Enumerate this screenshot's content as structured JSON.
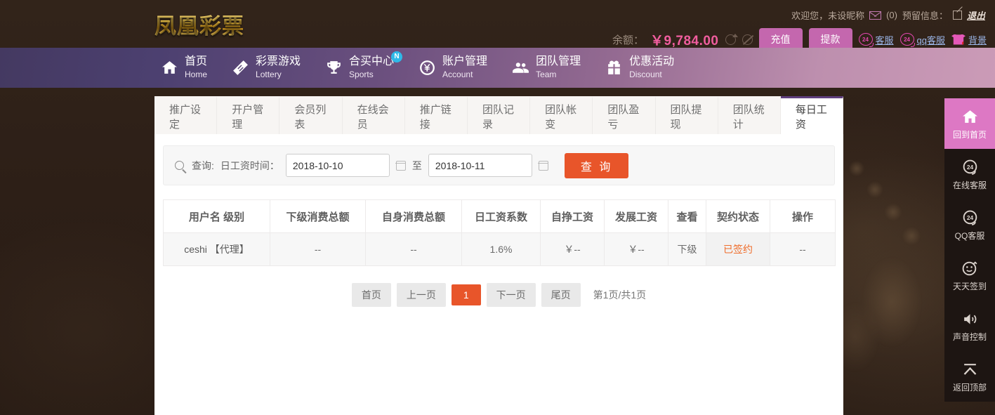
{
  "header": {
    "logo": "凤凰彩票",
    "welcome": "欢迎您，未设昵称",
    "mail_count": "(0)",
    "reserved_info_label": "预留信息：",
    "logout": "退出",
    "balance_label": "余额：",
    "balance_amount": "￥9,784.00",
    "recharge_button": "充值",
    "withdraw_button": "提款",
    "service_link": "客服",
    "qq_service_link": "qq客服",
    "background_link": "背景",
    "headset_badge": "24",
    "icons": {
      "mail": "mail-icon",
      "pen": "pen-icon",
      "refresh": "refresh-icon",
      "eye_off": "eye-off-icon",
      "shirt": "shirt-icon"
    }
  },
  "nav": {
    "items": [
      {
        "cn": "首页",
        "en": "Home",
        "icon": "home-icon",
        "badge": ""
      },
      {
        "cn": "彩票游戏",
        "en": "Lottery",
        "icon": "ticket-icon",
        "badge": ""
      },
      {
        "cn": "合买中心",
        "en": "Sports",
        "icon": "trophy-icon",
        "badge": "N"
      },
      {
        "cn": "账户管理",
        "en": "Account",
        "icon": "yen-coin-icon",
        "badge": ""
      },
      {
        "cn": "团队管理",
        "en": "Team",
        "icon": "people-icon",
        "badge": ""
      },
      {
        "cn": "优惠活动",
        "en": "Discount",
        "icon": "gift-icon",
        "badge": ""
      }
    ]
  },
  "tabs": {
    "items": [
      "推广设定",
      "开户管理",
      "会员列表",
      "在线会员",
      "推广链接",
      "团队记录",
      "团队帐变",
      "团队盈亏",
      "团队提现",
      "团队统计",
      "每日工资"
    ],
    "active_index": 10
  },
  "search": {
    "query_label": "查询:",
    "field_label": "日工资时间：",
    "date_from": "2018-10-10",
    "date_to": "2018-10-11",
    "between_label": "至",
    "submit_button": "查 询",
    "icons": {
      "magnifier": "search-icon",
      "calendar": "calendar-icon"
    }
  },
  "table": {
    "headers": [
      "用户名 级别",
      "下级消费总额",
      "自身消费总额",
      "日工资系数",
      "自挣工资",
      "发展工资",
      "查看",
      "契约状态",
      "操作"
    ],
    "rows": [
      {
        "username": "ceshi 【代理】",
        "sub_consume": "--",
        "self_consume": "--",
        "wage_rate": "1.6%",
        "self_wage": "￥--",
        "dev_wage": "￥--",
        "view": "下级",
        "contract_status": "已签约",
        "action": "--"
      }
    ]
  },
  "pagination": {
    "first": "首页",
    "prev": "上一页",
    "current": "1",
    "next": "下一页",
    "last": "尾页",
    "info": "第1页/共1页"
  },
  "right_sidebar": {
    "items": [
      {
        "label": "回到首页",
        "icon": "home-icon"
      },
      {
        "label": "在线客服",
        "icon": "headset-24-icon"
      },
      {
        "label": "QQ客服",
        "icon": "headset-24-icon"
      },
      {
        "label": "天天签到",
        "icon": "smiley-check-icon"
      },
      {
        "label": "声音控制",
        "icon": "speaker-icon"
      },
      {
        "label": "返回顶部",
        "icon": "arrow-up-icon"
      }
    ]
  },
  "colors": {
    "page_bg": "#2e2018",
    "nav_gradient_start": "#443961",
    "nav_gradient_end": "#cb9bb7",
    "accent_orange": "#e8552a",
    "accent_pink": "#c467ae",
    "balance_pink": "#f05d9e",
    "sidebar_home_pink": "#dd78c4",
    "active_tab_border": "#5f3f7e"
  }
}
